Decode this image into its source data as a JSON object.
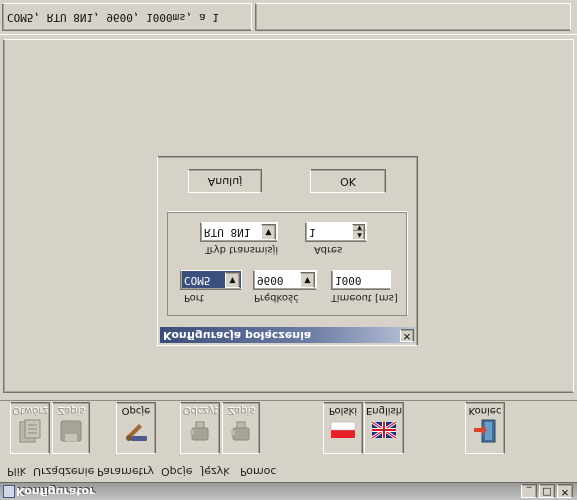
{
  "window": {
    "title": "Konfigurator"
  },
  "menu": [
    "Plik",
    "Urządzenie",
    "Parametry",
    "Opcje",
    "Język",
    "Pomoc"
  ],
  "toolbar": {
    "open": "Otwórz",
    "save": "Zapis",
    "options": "Opcje",
    "read": "Odczyt",
    "write": "Zapis",
    "polski": "Polski",
    "english": "English",
    "exit": "Koniec"
  },
  "dialog": {
    "title": "Konfiguracja połączenia",
    "port_label": "Port",
    "port_value": "COM5",
    "speed_label": "Prędkość",
    "speed_value": "9600",
    "timeout_label": "Timeout [ms]",
    "timeout_value": "1000",
    "mode_label": "Tryb transmisji",
    "mode_value": "RTU 8N1",
    "address_label": "Adres",
    "address_value": "1",
    "ok": "OK",
    "cancel": "Anuluj"
  },
  "status": {
    "connection": "COM5, RTU 8N1, 9600, 1000ms, a 1"
  }
}
